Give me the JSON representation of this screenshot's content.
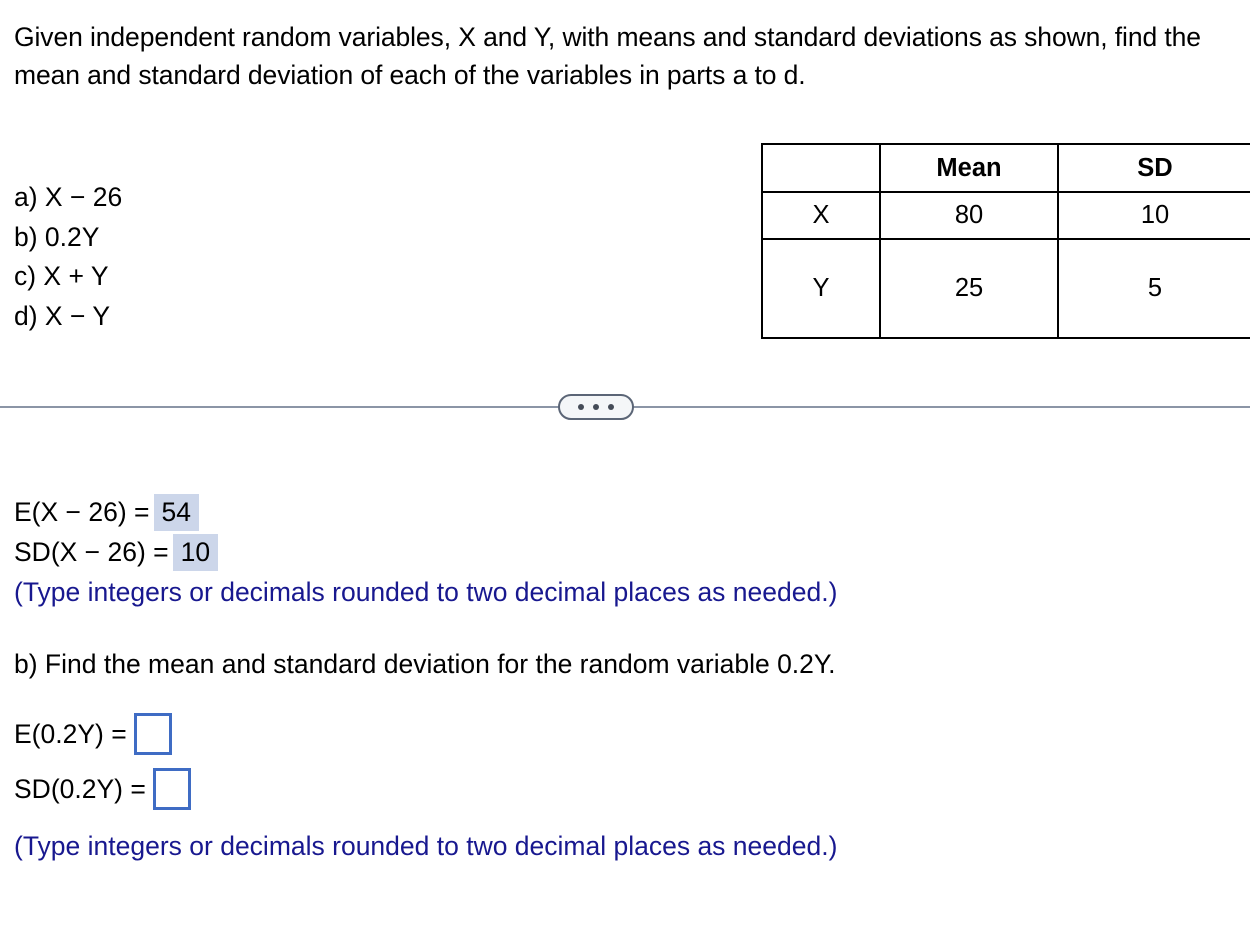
{
  "question": {
    "prompt": "Given independent random variables, X and Y, with means and standard deviations as shown, find the mean and standard deviation of each of the variables in parts a to d.",
    "parts": [
      "a) X − 26",
      "b) 0.2Y",
      "c) X + Y",
      "d) X − Y"
    ]
  },
  "stats_table": {
    "headers": [
      "",
      "Mean",
      "SD"
    ],
    "rows": [
      {
        "label": "X",
        "mean": "80",
        "sd": "10"
      },
      {
        "label": "Y",
        "mean": "25",
        "sd": "5"
      }
    ]
  },
  "divider": {
    "toggle_name": "ellipsis-toggle"
  },
  "answers": {
    "part_a": {
      "mean_label": "E(X − 26) =",
      "mean_value": "54",
      "sd_label": "SD(X − 26) =",
      "sd_value": "10",
      "note": "(Type integers or decimals rounded to two decimal places as needed.)"
    },
    "part_b": {
      "question": "b) Find the mean and standard deviation for the random variable 0.2Y.",
      "mean_label": "E(0.2Y) =",
      "mean_value": "",
      "sd_label": "SD(0.2Y) =",
      "sd_value": "",
      "note": "(Type integers or decimals rounded to two decimal places as needed.)"
    }
  },
  "colors": {
    "highlight": "#ccd6ea",
    "note_text": "#18188f",
    "input_border": "#3f6cc4",
    "divider_line": "#8b95a6"
  }
}
